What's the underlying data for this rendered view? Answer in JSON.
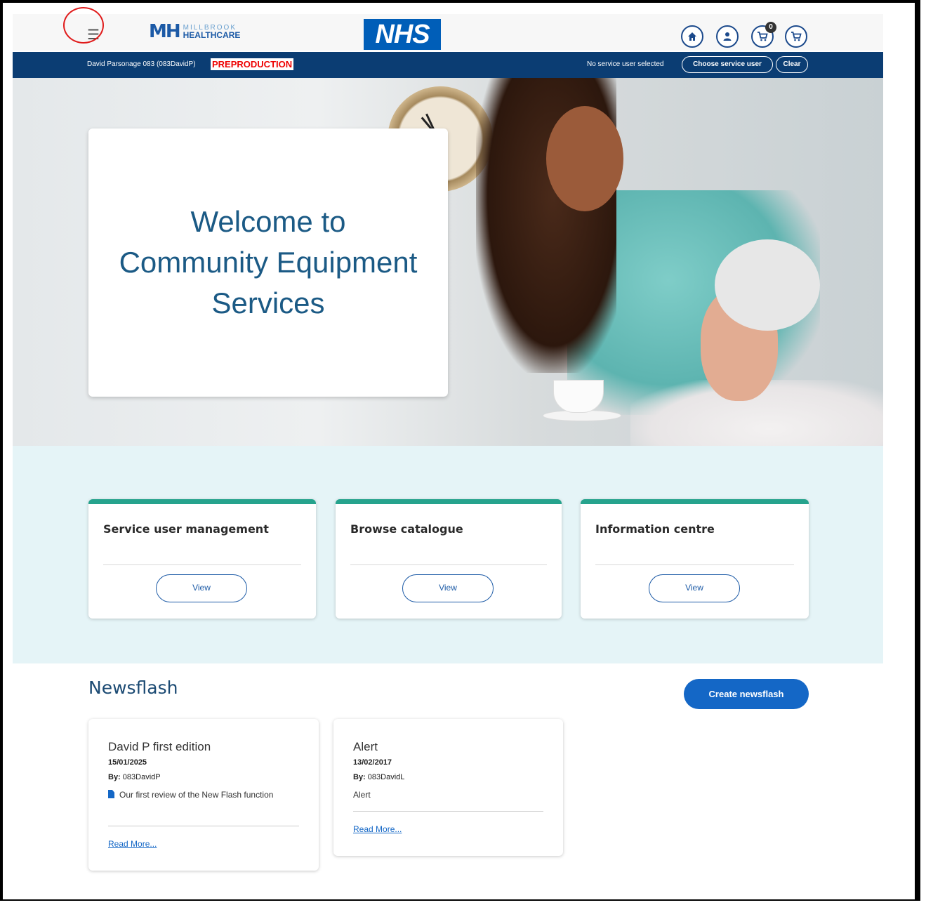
{
  "header": {
    "menu_icon": "hamburger-menu-icon",
    "logo": {
      "mark": "MH",
      "line1": "MILLBROOK",
      "line2": "HEALTHCARE"
    },
    "nhs_logo": "NHS",
    "icons": [
      "home-icon",
      "user-icon",
      "cart-icon",
      "basket-icon"
    ],
    "cart_count": "0"
  },
  "userbar": {
    "user_name": "David Parsonage 083 (083DavidP)",
    "environment": "PREPRODUCTION",
    "service_user_status": "No service user selected",
    "choose_label": "Choose service user",
    "clear_label": "Clear"
  },
  "hero": {
    "title": "Welcome to Community Equipment Services"
  },
  "tiles": [
    {
      "title": "Service user management",
      "button": "View"
    },
    {
      "title": "Browse catalogue",
      "button": "View"
    },
    {
      "title": "Information centre",
      "button": "View"
    }
  ],
  "newsflash": {
    "heading": "Newsflash",
    "create_label": "Create newsflash",
    "by_label": "By:",
    "items": [
      {
        "title": "David P first edition",
        "date": "15/01/2025",
        "author": "083DavidP",
        "body": "Our first review of the New Flash function",
        "has_doc_icon": true,
        "read_more": "Read More..."
      },
      {
        "title": "Alert",
        "date": "13/02/2017",
        "author": "083DavidL",
        "body": "Alert",
        "has_doc_icon": false,
        "read_more": "Read More..."
      }
    ]
  },
  "colors": {
    "nav_bar": "#0b3d73",
    "nhs_blue": "#005eb8",
    "tile_accent": "#26a38d",
    "band_bg": "#e5f4f7",
    "primary_button": "#1467c6",
    "preprod_red": "#ee0000"
  }
}
